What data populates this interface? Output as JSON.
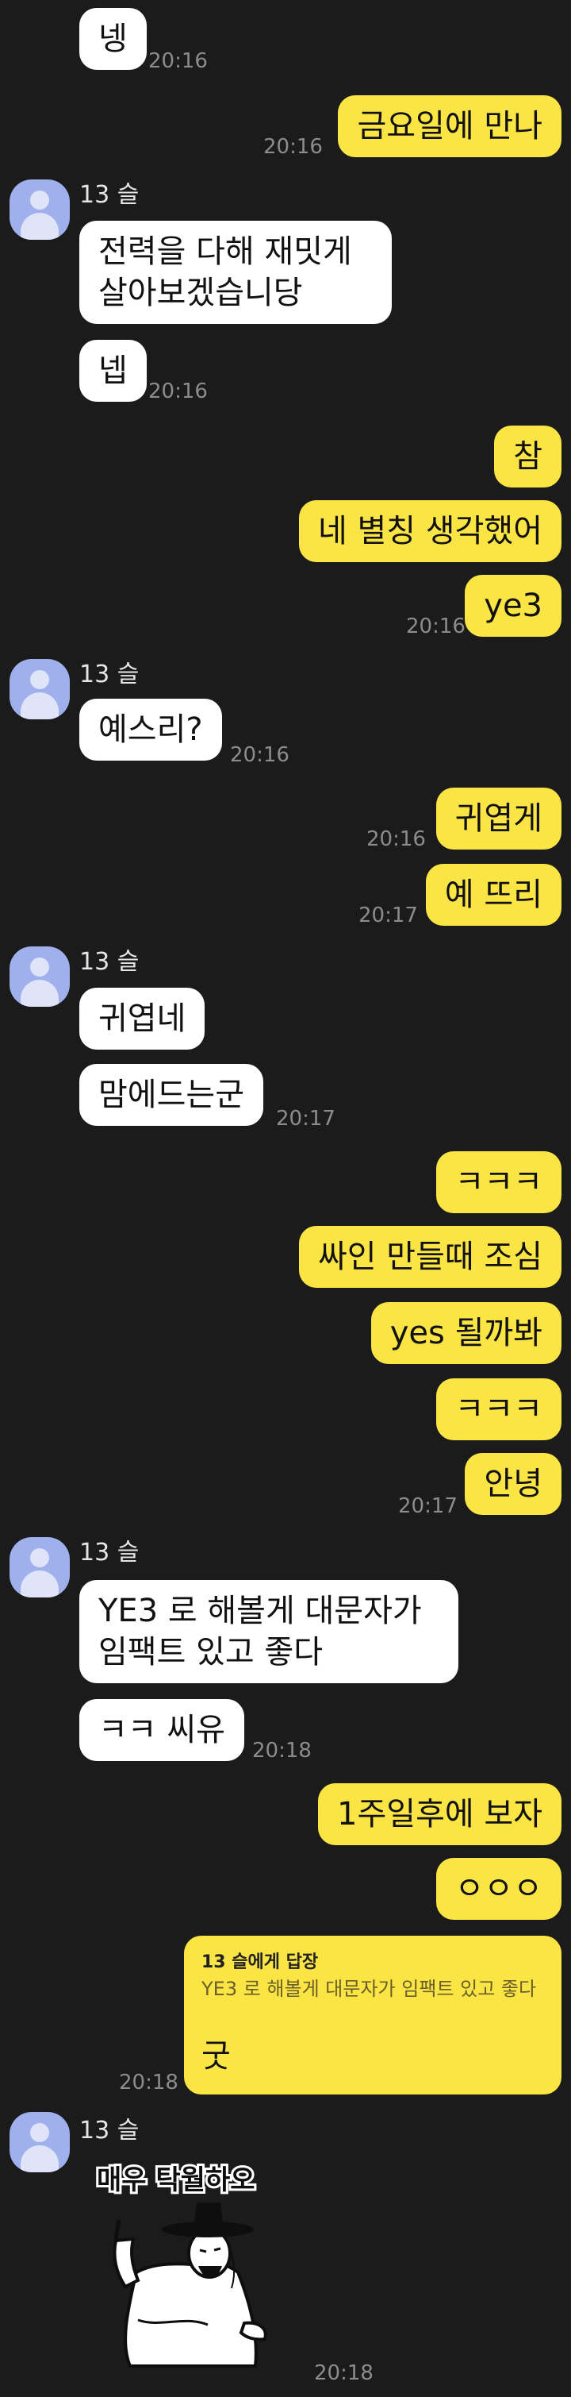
{
  "messages": {
    "m1": {
      "text": "넹",
      "time": "20:16"
    },
    "m2": {
      "text": "금요일에 만나",
      "time": "20:16"
    },
    "g1": {
      "sender": "13 슬",
      "msg1": "전력을 다해 재밋게\n살아보겠습니당",
      "msg2": "넵",
      "time": "20:16"
    },
    "m3": {
      "text": "참"
    },
    "m4": {
      "text": "네 별칭 생각했어"
    },
    "m5": {
      "text": "ye3",
      "time": "20:16"
    },
    "g2": {
      "sender": "13 슬",
      "msg1": "예스리?",
      "time": "20:16"
    },
    "m6": {
      "text": "귀엽게",
      "time": "20:16"
    },
    "m7": {
      "text": "예 뜨리",
      "time": "20:17"
    },
    "g3": {
      "sender": "13 슬",
      "msg1": "귀엽네",
      "msg2": "맘에드는군",
      "time": "20:17"
    },
    "m8": {
      "text": "ㅋㅋㅋ"
    },
    "m9": {
      "text": "싸인 만들때 조심"
    },
    "m10": {
      "text": "yes 될까봐"
    },
    "m11": {
      "text": "ㅋㅋㅋ"
    },
    "m12": {
      "text": "안녕",
      "time": "20:17"
    },
    "g4": {
      "sender": "13 슬",
      "msg1": "YE3 로 해볼게 대문자가\n임팩트 있고 좋다",
      "msg2": "ㅋㅋ 씨유",
      "time": "20:18"
    },
    "m13": {
      "text": "1주일후에 보자"
    },
    "m14": {
      "text": "ㅇㅇㅇ"
    },
    "reply": {
      "label": "13 슬에게 답장",
      "quote": "YE3 로 해볼게 대문자가 임팩트 있고 좋다",
      "text": "굿",
      "time": "20:18"
    },
    "g5": {
      "sender": "13 슬",
      "sticker_text": "매우 탁월하오",
      "time": "20:18"
    }
  },
  "colors": {
    "background": "#1b1b1b",
    "outgoing_bubble": "#fbe545",
    "incoming_bubble": "#ffffff",
    "avatar": "#9fb0ec"
  },
  "icons": {
    "avatar": "person-silhouette-icon",
    "sticker": "scholar-gat-sticker"
  }
}
